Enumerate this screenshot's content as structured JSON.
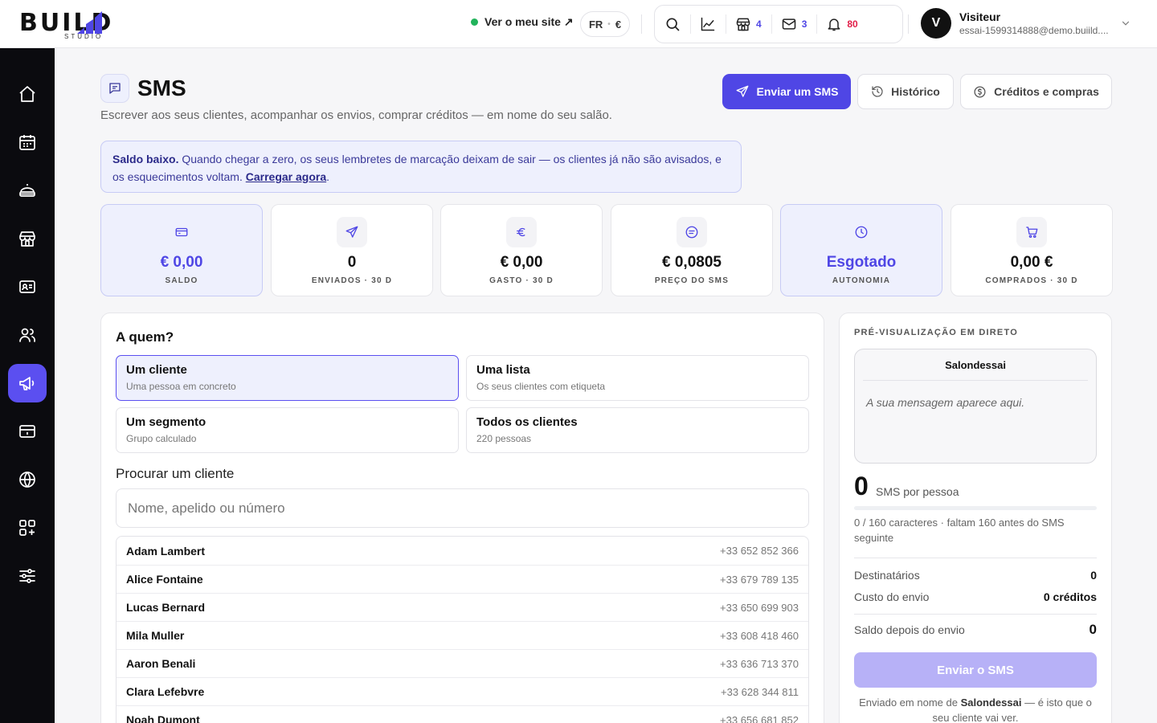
{
  "brand": {
    "logo_word": "BUILD",
    "logo_sub": "STUDIO"
  },
  "topbar": {
    "site_link": "Ver o meu site ↗",
    "lang": "FR",
    "currency": "€",
    "counts": {
      "shop": "4",
      "mail": "3",
      "bell": "80"
    },
    "user_initial": "V",
    "user_name": "Visiteur",
    "user_email": "essai-1599314888@demo.buiild...."
  },
  "sidebar": [
    "home-icon",
    "calendar-icon",
    "services-icon",
    "shop-icon",
    "contacts-icon",
    "team-icon",
    "megaphone-icon",
    "card-icon",
    "globe-icon",
    "apps-icon",
    "settings-icon"
  ],
  "header": {
    "title": "SMS",
    "subtitle": "Escrever aos seus clientes, acompanhar os envios, comprar créditos — em nome do seu salão.",
    "send_label": "Enviar um SMS",
    "history_label": "Histórico",
    "credits_label": "Créditos e compras"
  },
  "alert": {
    "bold": "Saldo baixo.",
    "text": "Quando chegar a zero, os seus lembretes de marcação deixam de sair — os clientes já não são avisados, e os esquecimentos voltam.",
    "link": "Carregar agora",
    "end": "."
  },
  "stats": [
    {
      "value": "€ 0,00",
      "label": "SALDO",
      "icon": "wallet-icon"
    },
    {
      "value": "0",
      "label": "ENVIADOS · 30 D",
      "icon": "send-icon"
    },
    {
      "value": "€ 0,00",
      "label": "GASTO · 30 D",
      "icon": "euro-icon"
    },
    {
      "value": "€ 0,0805",
      "label": "PREÇO DO SMS",
      "icon": "price-icon"
    },
    {
      "value": "Esgotado",
      "label": "AUTONOMIA",
      "icon": "clock-icon"
    },
    {
      "value": "0,00 €",
      "label": "COMPRADOS · 30 D",
      "icon": "cart-icon"
    }
  ],
  "audience": {
    "title": "A quem?",
    "options": [
      {
        "title": "Um cliente",
        "desc": "Uma pessoa em concreto"
      },
      {
        "title": "Uma lista",
        "desc": "Os seus clientes com etiqueta"
      },
      {
        "title": "Um segmento",
        "desc": "Grupo calculado"
      },
      {
        "title": "Todos os clientes",
        "desc": "220 pessoas"
      }
    ],
    "selected_index": 0
  },
  "search": {
    "label": "Procurar um cliente",
    "placeholder": "Nome, apelido ou número",
    "value": ""
  },
  "clients": [
    {
      "name": "Adam Lambert",
      "phone": "+33 652 852 366"
    },
    {
      "name": "Alice Fontaine",
      "phone": "+33 679 789 135"
    },
    {
      "name": "Lucas Bernard",
      "phone": "+33 650 699 903"
    },
    {
      "name": "Mila Muller",
      "phone": "+33 608 418 460"
    },
    {
      "name": "Aaron Benali",
      "phone": "+33 636 713 370"
    },
    {
      "name": "Clara Lefebvre",
      "phone": "+33 628 344 811"
    },
    {
      "name": "Noah Dumont",
      "phone": "+33 656 681 852"
    }
  ],
  "preview": {
    "title": "PRÉ-VISUALIZAÇÃO EM DIRETO",
    "sender": "Salondessai",
    "message": "A sua mensagem aparece aqui.",
    "sms_count": "0",
    "sms_count_label": "SMS por pessoa",
    "char_progress": 0,
    "chars_text": "0 / 160 caracteres · faltam 160 antes do SMS seguinte",
    "recipients_label": "Destinatários",
    "recipients_value": "0",
    "cost_label": "Custo do envio",
    "cost_value": "0 créditos",
    "balance_after_label": "Saldo depois do envio",
    "balance_after_value": "0",
    "send_label": "Enviar o SMS",
    "footer_pre": "Enviado em nome de",
    "footer_name": "Salondessai",
    "footer_post": "— é isto que o seu cliente vai ver."
  },
  "colors": {
    "accent": "#4f46e5",
    "accent_soft": "#eef0fd",
    "sidebar": "#0b0b0f",
    "online": "#22b35b",
    "alert_red": "#e11d48"
  }
}
